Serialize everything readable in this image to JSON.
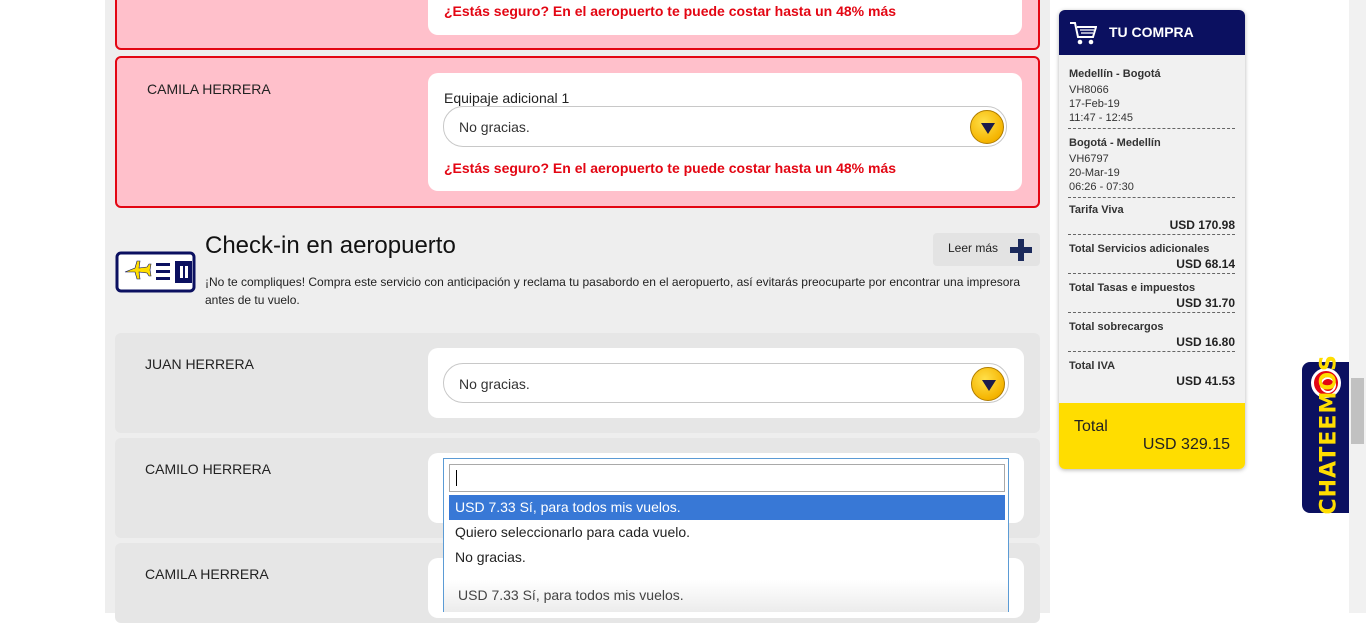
{
  "baggage_section": {
    "warning_text": "¿Estás seguro? En el aeropuerto te puede costar hasta un 48% más",
    "passengers": [
      {
        "name": "CAMILA HERRERA",
        "field_label": "Equipaje adicional 1",
        "selected_value": "No gracias.",
        "warning": "¿Estás seguro? En el aeropuerto te puede costar hasta un 48% más"
      }
    ]
  },
  "checkin_section": {
    "title": "Check-in en aeropuerto",
    "description": "¡No te compliques! Compra este servicio con anticipación y reclama tu pasabordo en el aeropuerto, así evitarás preocuparte por encontrar una impresora antes de tu vuelo.",
    "read_more_label": "Leer más",
    "icon": "ticket-plane-icon",
    "passengers": [
      {
        "name": "JUAN HERRERA",
        "selected_value": "No gracias."
      },
      {
        "name": "CAMILO HERRERA",
        "selected_value": ""
      },
      {
        "name": "CAMILA HERRERA",
        "selected_value": "USD 7.33 Sí, para todos mis vuelos."
      }
    ],
    "dropdown": {
      "search_value": "",
      "options": [
        "USD 7.33 Sí, para todos mis vuelos.",
        "Quiero seleccionarlo para cada vuelo.",
        "No gracias."
      ],
      "highlighted_index": 0
    }
  },
  "summary": {
    "title": "TU COMPRA",
    "flights": [
      {
        "route": "Medellín - Bogotá",
        "code": "VH8066",
        "date": "17-Feb-19",
        "time": "11:47 - 12:45"
      },
      {
        "route": "Bogotá - Medellín",
        "code": "VH6797",
        "date": "20-Mar-19",
        "time": "06:26 - 07:30"
      }
    ],
    "lines": [
      {
        "label": "Tarifa Viva",
        "amount": "USD 170.98"
      },
      {
        "label": "Total Servicios adicionales",
        "amount": "USD 68.14"
      },
      {
        "label": "Total Tasas e impuestos",
        "amount": "USD 31.70"
      },
      {
        "label": "Total sobrecargos",
        "amount": "USD 16.80"
      },
      {
        "label": "Total IVA",
        "amount": "USD 41.53"
      }
    ],
    "total_label": "Total",
    "total_amount": "USD 329.15"
  },
  "chat": {
    "label": "CHATEEMOS"
  },
  "colors": {
    "navy": "#0b1060",
    "yellow": "#ffdd00",
    "red": "#e30613",
    "pink": "#ffc0cb",
    "highlight": "#3878d6"
  }
}
